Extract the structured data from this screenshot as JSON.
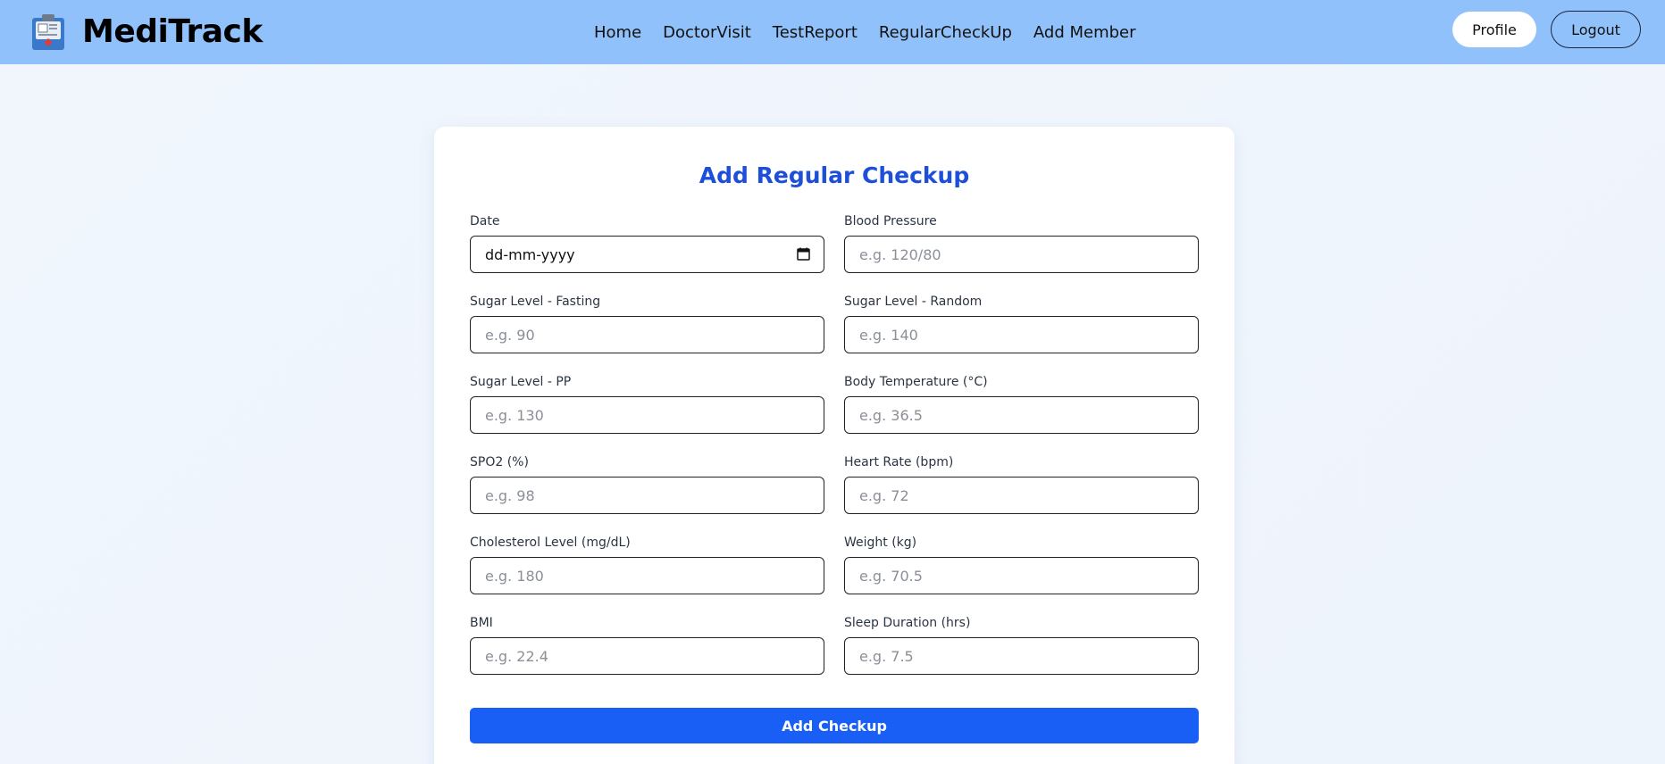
{
  "app": {
    "name": "MediTrack"
  },
  "nav": {
    "links": [
      "Home",
      "DoctorVisit",
      "TestReport",
      "RegularCheckUp",
      "Add Member"
    ],
    "profile_label": "Profile",
    "logout_label": "Logout"
  },
  "form": {
    "title": "Add Regular Checkup",
    "fields": [
      {
        "label": "Date",
        "value": "dd-mm-yyyy",
        "placeholder": ""
      },
      {
        "label": "Blood Pressure",
        "value": "",
        "placeholder": "e.g. 120/80"
      },
      {
        "label": "Sugar Level - Fasting",
        "value": "",
        "placeholder": "e.g. 90"
      },
      {
        "label": "Sugar Level - Random",
        "value": "",
        "placeholder": "e.g. 140"
      },
      {
        "label": "Sugar Level - PP",
        "value": "",
        "placeholder": "e.g. 130"
      },
      {
        "label": "Body Temperature (°C)",
        "value": "",
        "placeholder": "e.g. 36.5"
      },
      {
        "label": "SPO2 (%)",
        "value": "",
        "placeholder": "e.g. 98"
      },
      {
        "label": "Heart Rate (bpm)",
        "value": "",
        "placeholder": "e.g. 72"
      },
      {
        "label": "Cholesterol Level (mg/dL)",
        "value": "",
        "placeholder": "e.g. 180"
      },
      {
        "label": "Weight (kg)",
        "value": "",
        "placeholder": "e.g. 70.5"
      },
      {
        "label": "BMI",
        "value": "",
        "placeholder": "e.g. 22.4"
      },
      {
        "label": "Sleep Duration (hrs)",
        "value": "",
        "placeholder": "e.g. 7.5"
      }
    ],
    "submit_label": "Add Checkup"
  },
  "icons": {
    "logo": "medical-clipboard-icon",
    "date": "calendar-icon"
  },
  "colors": {
    "navbar": "#90c1fb",
    "title": "#1d4fd8",
    "submit": "#1a5ff5"
  }
}
